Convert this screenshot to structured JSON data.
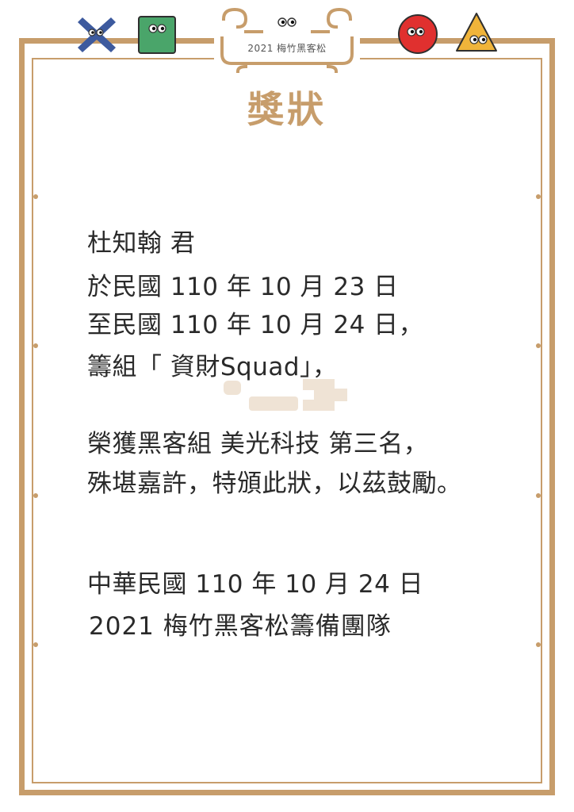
{
  "header": {
    "crest_text": "2021 梅竹黑客松",
    "title": "獎狀"
  },
  "certificate": {
    "recipient": "杜知翰 君",
    "date_line_1": "於民國 110 年 10 月 23 日",
    "date_line_2": "至民國 110 年 10 月 24 日，",
    "team_line": "籌組「 資財Squad」，",
    "award_line": "榮獲黑客組 美光科技 第三名，",
    "praise_line": "殊堪嘉許，特頒此狀，以茲鼓勵。",
    "issue_date": "中華民國 110 年 10 月 24 日",
    "issuer": "2021 梅竹黑客松籌備團隊"
  },
  "colors": {
    "frame": "#c79d6b",
    "text": "#2a2a2a",
    "x_icon": "#3d5a9e",
    "square_icon": "#4aa56a",
    "circle_icon": "#e0302f",
    "triangle_icon": "#f0b43a"
  },
  "icons": [
    "x-icon",
    "green-square-icon",
    "red-circle-icon",
    "yellow-triangle-icon",
    "crest-ornament-icon",
    "watermark-logo-icon"
  ]
}
